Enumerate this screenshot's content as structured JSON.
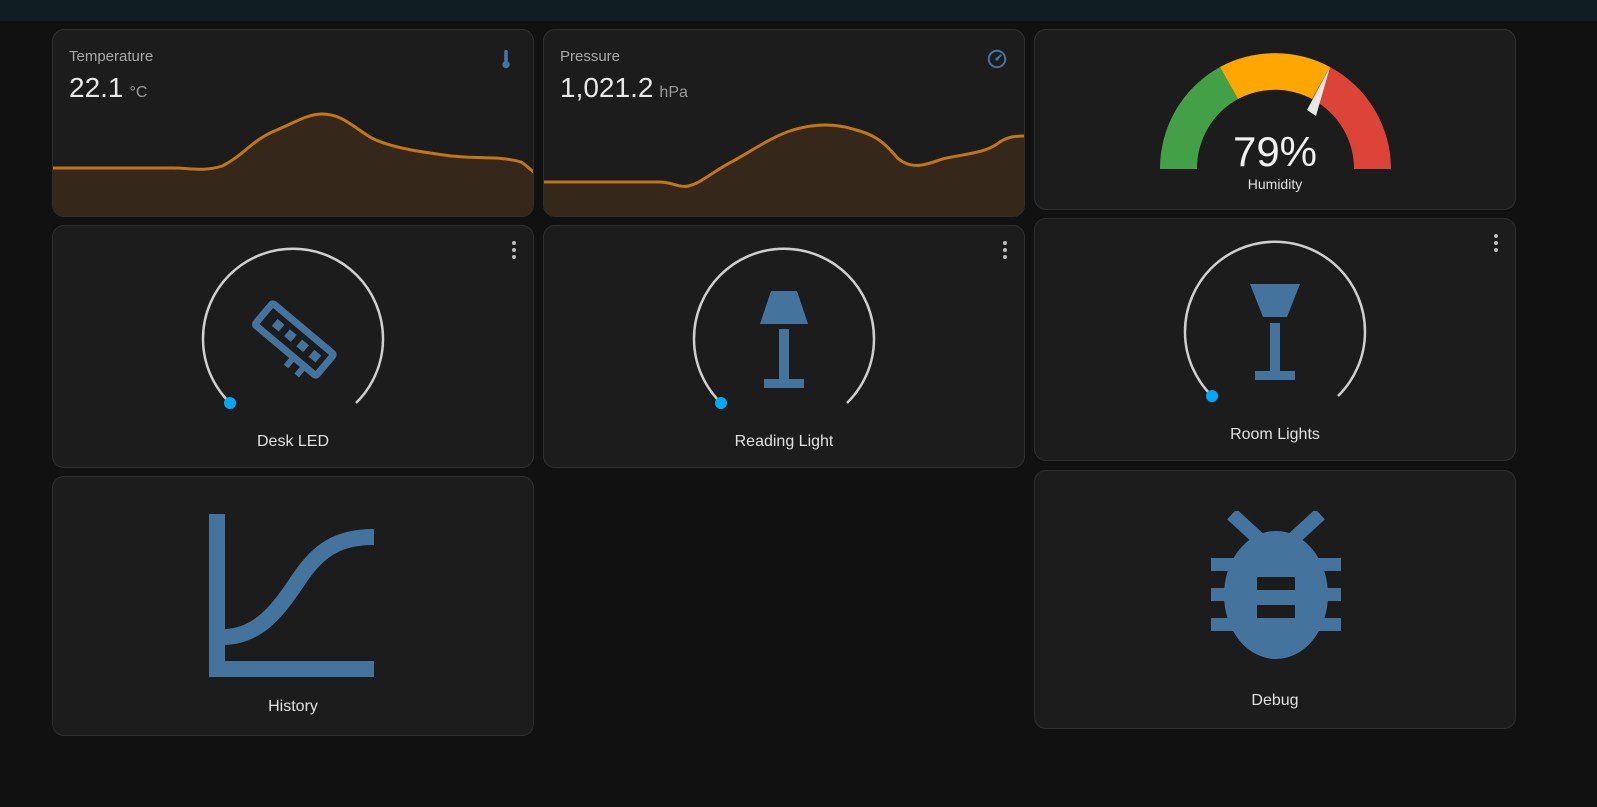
{
  "sensors": [
    {
      "name": "Temperature",
      "value": "22.1",
      "unit": "°C",
      "icon": "thermometer-icon"
    },
    {
      "name": "Pressure",
      "value": "1,021.2",
      "unit": "hPa",
      "icon": "gauge-icon"
    }
  ],
  "humidity": {
    "value": "79%",
    "label": "Humidity",
    "level": 0.79,
    "colors": {
      "green": "#43a047",
      "yellow": "#ffa600",
      "red": "#db4437"
    }
  },
  "lights": [
    {
      "name": "Desk LED",
      "icon": "led-strip-icon"
    },
    {
      "name": "Reading Light",
      "icon": "floor-lamp-icon"
    },
    {
      "name": "Room Lights",
      "icon": "lamp-icon"
    }
  ],
  "buttons": [
    {
      "name": "History",
      "icon": "chart-line-icon"
    },
    {
      "name": "Debug",
      "icon": "bug-icon"
    }
  ],
  "colors": {
    "accent": "#44739e",
    "sparkline": "#c27616",
    "slider_dot": "#03a9f4"
  }
}
